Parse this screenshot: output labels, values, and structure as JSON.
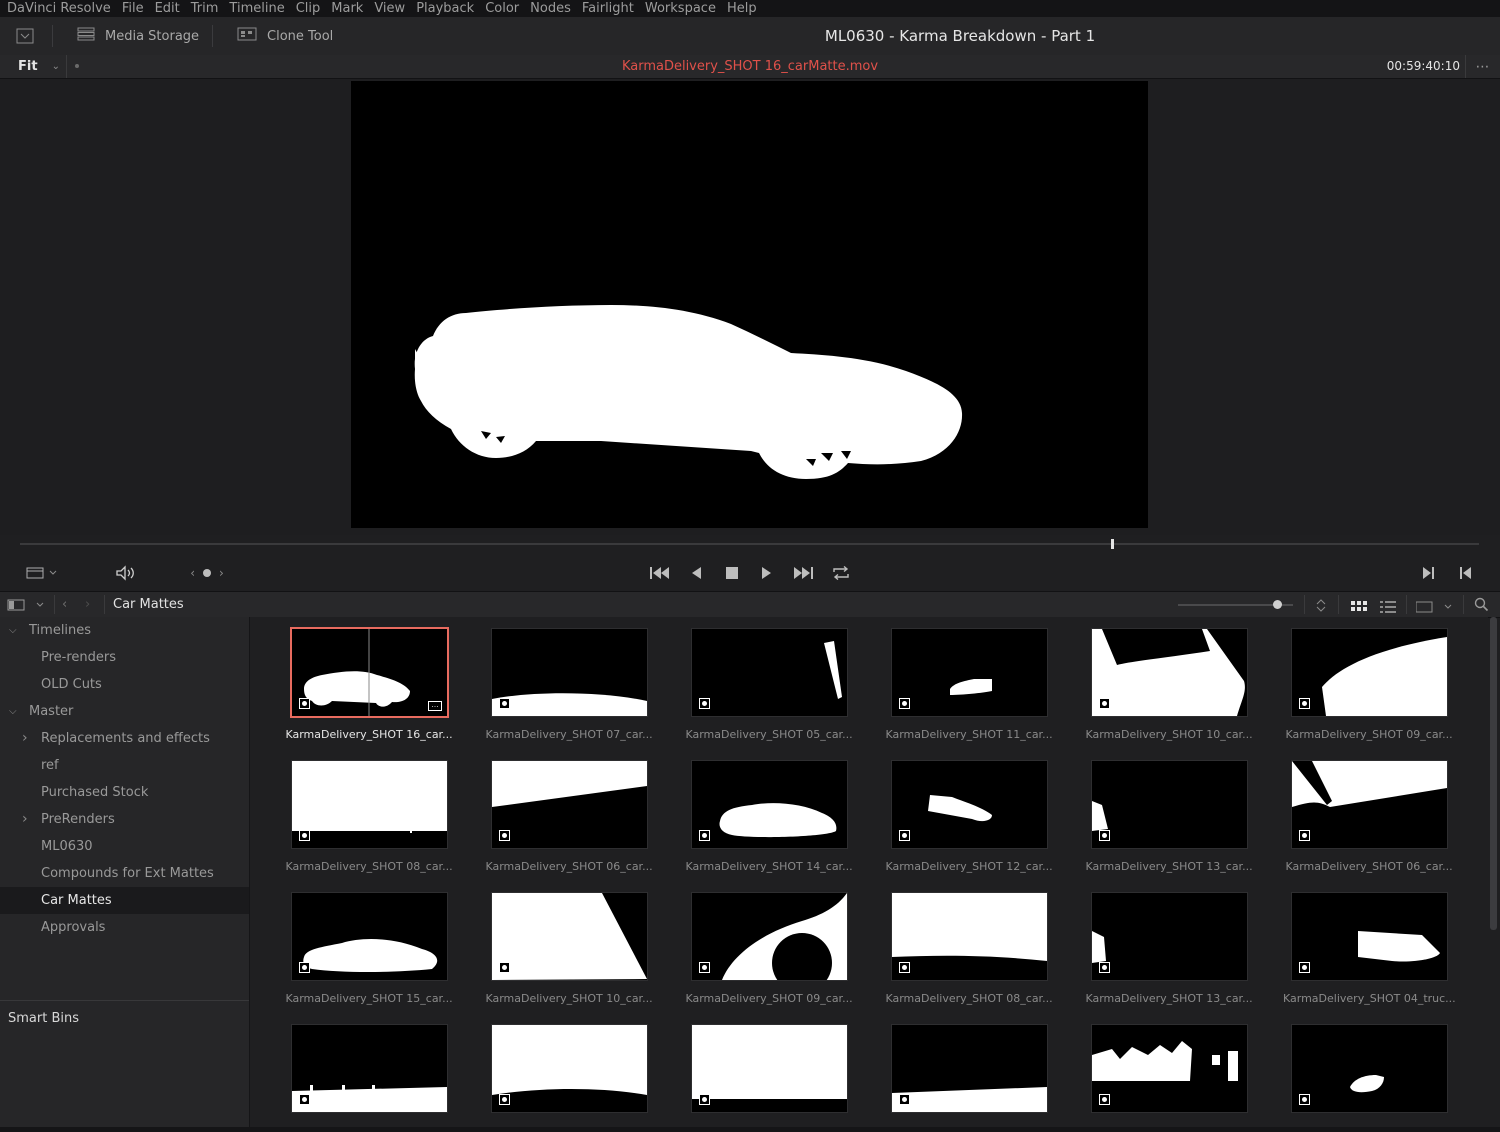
{
  "menu": [
    "DaVinci Resolve",
    "File",
    "Edit",
    "Trim",
    "Timeline",
    "Clip",
    "Mark",
    "View",
    "Playback",
    "Color",
    "Nodes",
    "Fairlight",
    "Workspace",
    "Help"
  ],
  "toolbar": {
    "media_storage": "Media Storage",
    "clone_tool": "Clone Tool",
    "project_title": "ML0630 - Karma Breakdown - Part 1"
  },
  "viewer": {
    "zoom": "Fit",
    "clip_name": "KarmaDelivery_SHOT 16_carMatte.mov",
    "timecode": "00:59:40:10",
    "playhead_position": 0.748
  },
  "bin": {
    "title": "Car Mattes"
  },
  "sidebar": {
    "items": [
      {
        "label": "Timelines",
        "indent": 0,
        "expander": "down"
      },
      {
        "label": "Pre-renders",
        "indent": 1
      },
      {
        "label": "OLD Cuts",
        "indent": 1
      },
      {
        "label": "Master",
        "indent": 0,
        "expander": "down"
      },
      {
        "label": "Replacements and effects",
        "indent": 1,
        "expander": "right"
      },
      {
        "label": "ref",
        "indent": 1
      },
      {
        "label": "Purchased Stock",
        "indent": 1
      },
      {
        "label": "PreRenders",
        "indent": 1,
        "expander": "right"
      },
      {
        "label": "ML0630",
        "indent": 1
      },
      {
        "label": "Compounds for Ext Mattes",
        "indent": 1
      },
      {
        "label": "Car Mattes",
        "indent": 1,
        "selected": true
      },
      {
        "label": "Approvals",
        "indent": 1
      }
    ],
    "smart_bins": "Smart Bins"
  },
  "clips": [
    {
      "label": "KarmaDelivery_SHOT 16_car...",
      "shape": "car",
      "selected": true
    },
    {
      "label": "KarmaDelivery_SHOT 07_car...",
      "shape": "ground-curve"
    },
    {
      "label": "KarmaDelivery_SHOT 05_car...",
      "shape": "sliver-right"
    },
    {
      "label": "KarmaDelivery_SHOT 11_car...",
      "shape": "small-car"
    },
    {
      "label": "KarmaDelivery_SHOT 10_car...",
      "shape": "white-wedge"
    },
    {
      "label": "KarmaDelivery_SHOT 09_car...",
      "shape": "hood-right"
    },
    {
      "label": "KarmaDelivery_SHOT 08_car...",
      "shape": "white-top"
    },
    {
      "label": "KarmaDelivery_SHOT 06_car...",
      "shape": "diagonal-top"
    },
    {
      "label": "KarmaDelivery_SHOT 14_car...",
      "shape": "car-mid"
    },
    {
      "label": "KarmaDelivery_SHOT 12_car...",
      "shape": "small-car-2"
    },
    {
      "label": "KarmaDelivery_SHOT 13_car...",
      "shape": "left-sliver"
    },
    {
      "label": "KarmaDelivery_SHOT 06_car...",
      "shape": "diagonal-top-2"
    },
    {
      "label": "KarmaDelivery_SHOT 15_car...",
      "shape": "car-low"
    },
    {
      "label": "KarmaDelivery_SHOT 10_car...",
      "shape": "white-big-wedge"
    },
    {
      "label": "KarmaDelivery_SHOT 09_car...",
      "shape": "wheel-arch"
    },
    {
      "label": "KarmaDelivery_SHOT 08_car...",
      "shape": "white-top-2"
    },
    {
      "label": "KarmaDelivery_SHOT 13_car...",
      "shape": "left-sliver-2"
    },
    {
      "label": "KarmaDelivery_SHOT 04_truc...",
      "shape": "truck"
    },
    {
      "label": "",
      "shape": "ground-low"
    },
    {
      "label": "",
      "shape": "white-top-3"
    },
    {
      "label": "",
      "shape": "white-top-4"
    },
    {
      "label": "",
      "shape": "ground-low-2"
    },
    {
      "label": "",
      "shape": "skyline"
    },
    {
      "label": "",
      "shape": "small-car-3"
    }
  ]
}
